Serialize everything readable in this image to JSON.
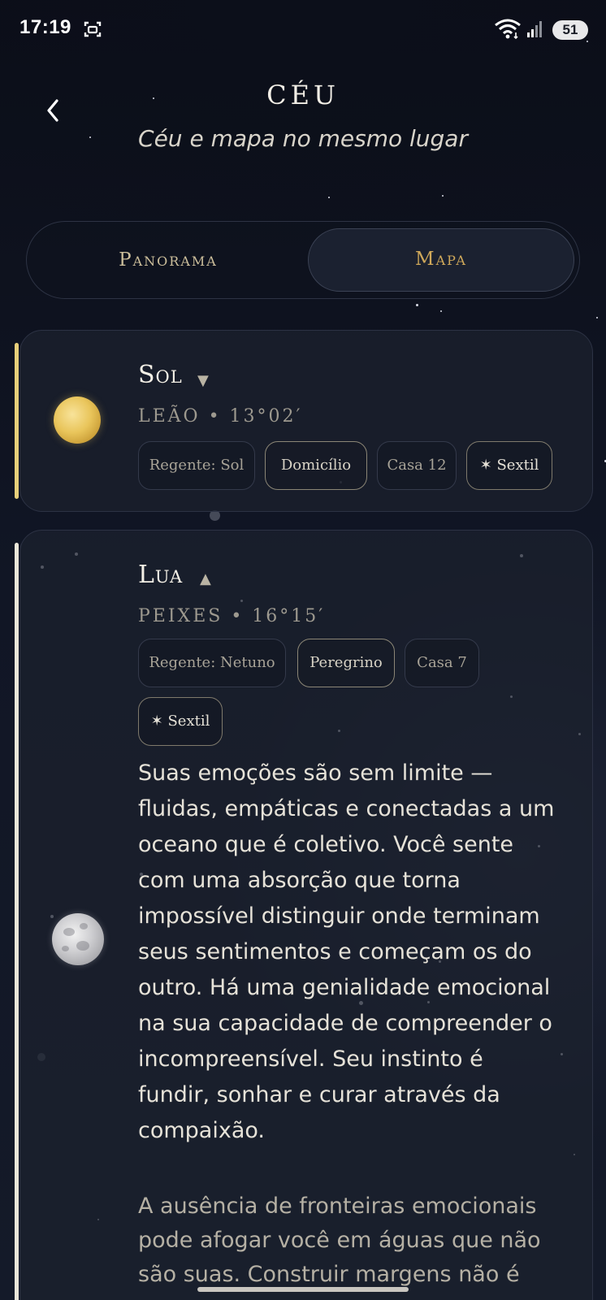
{
  "status_bar": {
    "time": "17:19",
    "battery": "51"
  },
  "header": {
    "title": "CÉU",
    "subtitle": "Céu e mapa no mesmo lugar"
  },
  "tabs": [
    {
      "label": "Panorama",
      "selected": false
    },
    {
      "label": "Mapa",
      "selected": true
    }
  ],
  "planets": [
    {
      "name": "Sol",
      "caret": "▼",
      "sign": "LEÃO • 13°02′",
      "chips": [
        "Regente: Sol",
        "Domicílio",
        "Casa 12",
        "✶ Sextil"
      ],
      "accent_color": "#e7cf7a"
    },
    {
      "name": "Lua",
      "caret": "▲",
      "sign": "PEIXES • 16°15′",
      "chips": [
        "Regente: Netuno",
        "Peregrino",
        "Casa 7",
        "✶ Sextil"
      ],
      "accent_color": "#ebe7da",
      "description": "Suas emoções são sem limite — fluidas, empáticas e conectadas a um oceano que é coletivo. Você sente com uma absorção que torna impossível distinguir onde terminam seus sentimentos e começam os do outro. Há uma genialidade emocional na sua capacidade de compreender o incompreensível. Seu instinto é fundir, sonhar e curar através da compaixão.",
      "note": "A ausência de fronteiras emocionais pode afogar você em águas que não são suas. Construir margens não é"
    }
  ],
  "icons": {
    "back": "chevron-left-icon",
    "screenshot": "screenshot-icon",
    "wifi": "wifi-icon",
    "signal": "signal-icon",
    "sun": "sun-icon",
    "moon": "moon-icon"
  }
}
